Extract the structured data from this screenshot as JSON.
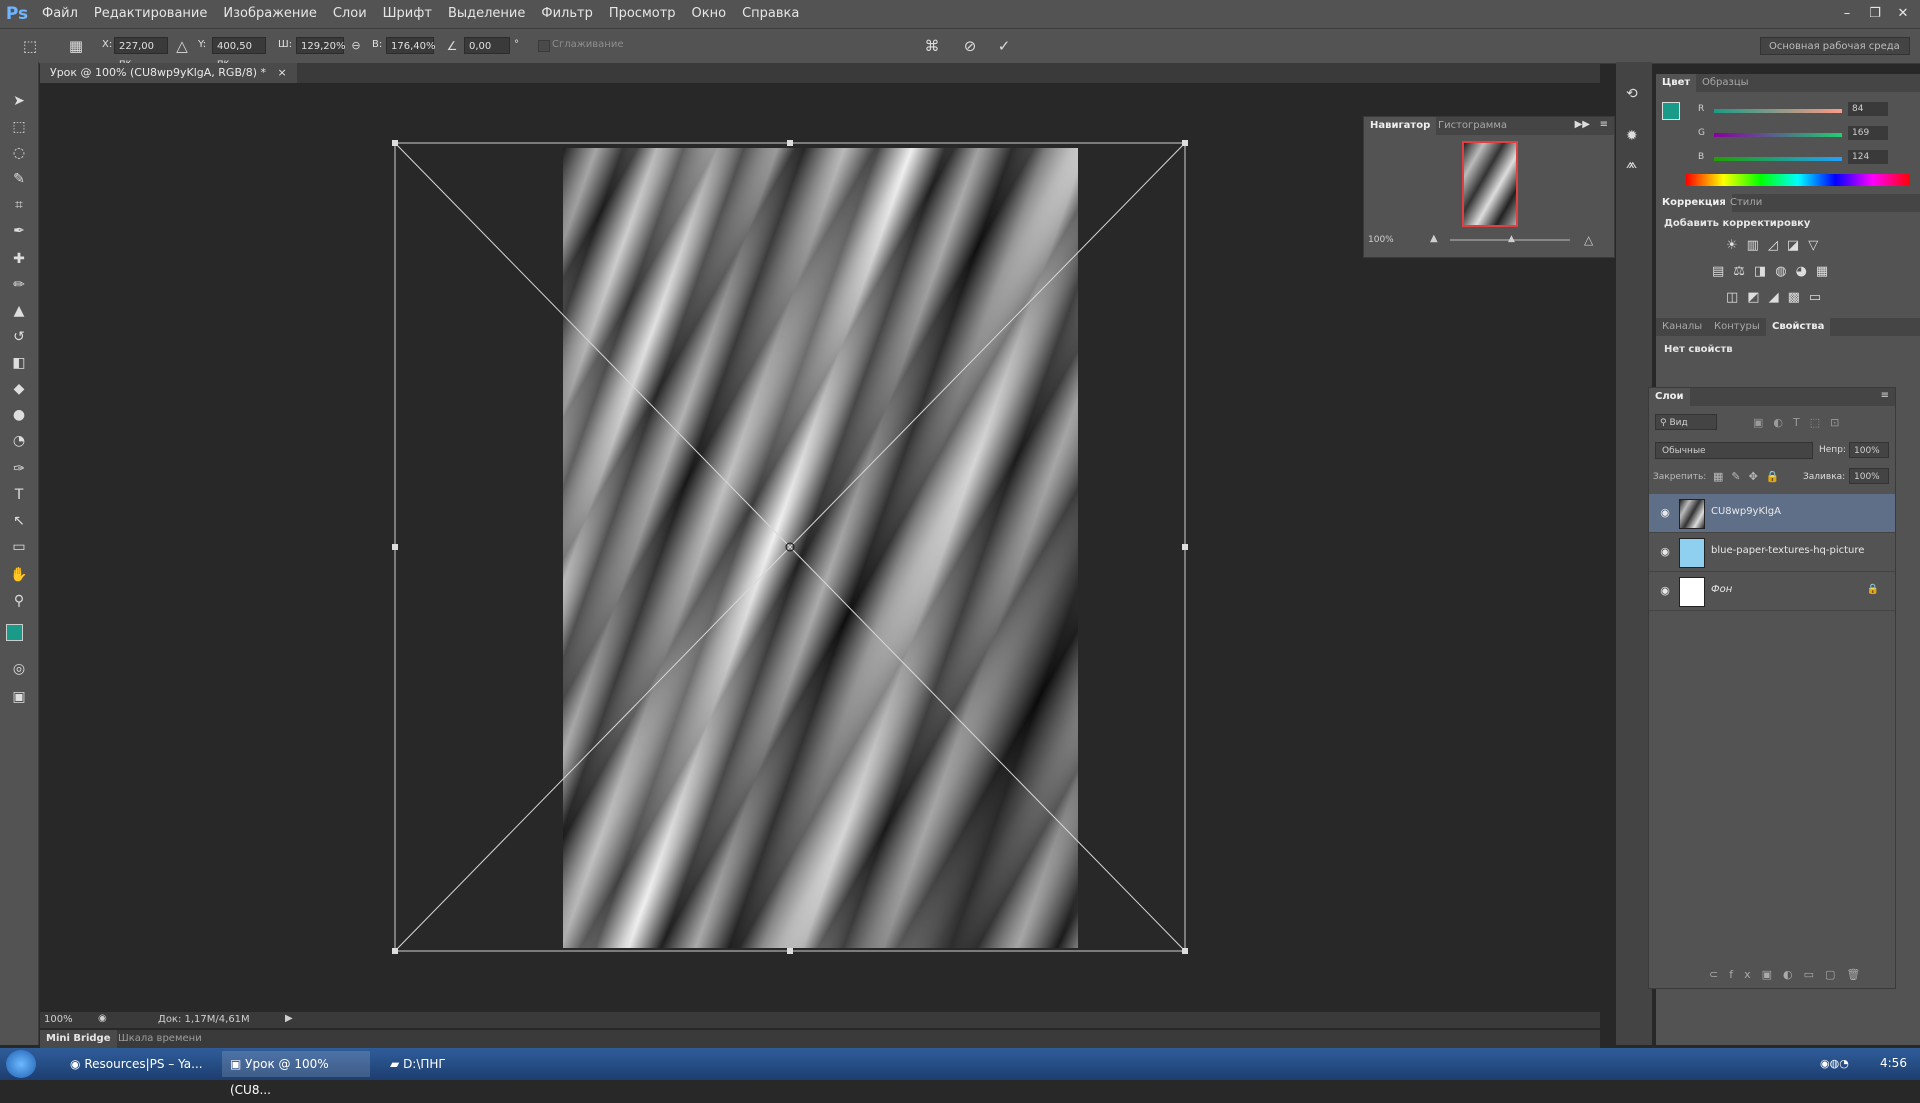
{
  "app": {
    "logo": "Ps"
  },
  "menu": [
    "Файл",
    "Редактирование",
    "Изображение",
    "Слои",
    "Шрифт",
    "Выделение",
    "Фильтр",
    "Просмотр",
    "Окно",
    "Справка"
  ],
  "window_controls": {
    "minimize": "–",
    "restore": "❐",
    "close": "✕"
  },
  "options": {
    "x_label": "X:",
    "x_value": "227,00 пк",
    "y_label": "Y:",
    "y_value": "400,50 пк",
    "w_label": "Ш:",
    "w_value": "129,20%",
    "h_label": "В:",
    "h_value": "176,40%",
    "angle_value": "0,00",
    "angle_unit": "°",
    "smoothing_label": "Сглаживание",
    "workspace": "Основная рабочая среда"
  },
  "document_tab": {
    "title": "Урок @ 100% (CU8wp9yKlgA, RGB/8) *",
    "close": "×"
  },
  "status": {
    "zoom": "100%",
    "doc": "Док: 1,17M/4,61M"
  },
  "bottom_tabs": [
    "Mini Bridge",
    "Шкала времени"
  ],
  "navigator": {
    "tabs": [
      "Навигатор",
      "Гистограмма"
    ],
    "zoom": "100%"
  },
  "color_panel": {
    "tabs": [
      "Цвет",
      "Образцы"
    ],
    "r_label": "R",
    "g_label": "G",
    "b_label": "B",
    "r": "84",
    "g": "169",
    "b": "124",
    "fg_color": "#1a9a88",
    "bg_color": "#ffffff"
  },
  "corrections": {
    "tabs": [
      "Коррекция",
      "Стили"
    ],
    "subtitle": "Добавить корректировку"
  },
  "properties": {
    "tabs": [
      "Каналы",
      "Контуры",
      "Свойства"
    ],
    "empty": "Нет свойств"
  },
  "layers": {
    "title": "Слои",
    "filter": "Вид",
    "blend_mode": "Обычные",
    "opacity_label": "Непр:",
    "opacity": "100%",
    "lock_label": "Закрепить:",
    "fill_label": "Заливка:",
    "fill": "100%",
    "items": [
      {
        "name": "CU8wp9yKlgA"
      },
      {
        "name": "blue-paper-textures-hq-picture"
      },
      {
        "name": "Фон"
      }
    ]
  },
  "taskbar": {
    "items": [
      "Resources|PS – Ya...",
      "Урок @ 100% (CU8...",
      "D:\\ПНГ"
    ],
    "clock": "4:56"
  }
}
